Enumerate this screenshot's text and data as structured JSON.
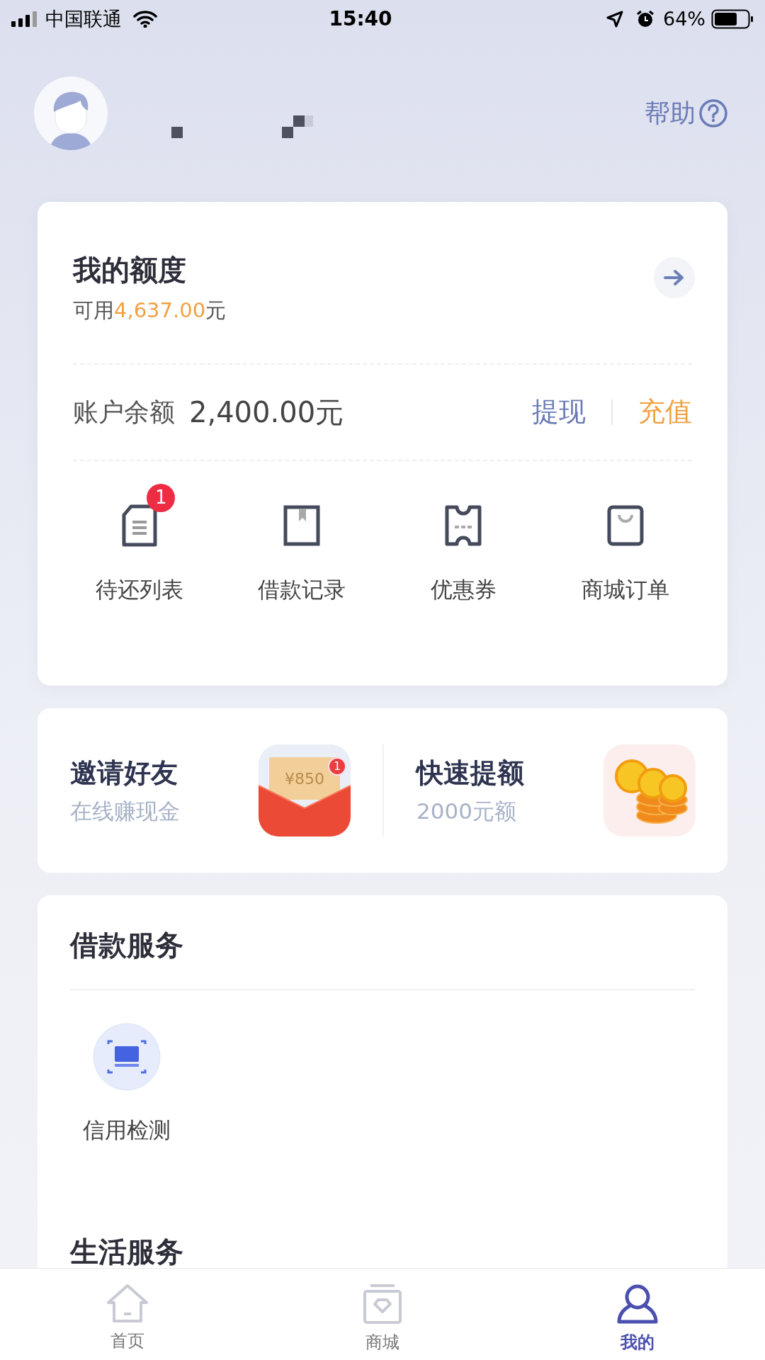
{
  "status_bar": {
    "carrier": "中国联通",
    "time": "15:40",
    "battery": "64%"
  },
  "header": {
    "help": "帮助"
  },
  "credit": {
    "title": "我的额度",
    "available_prefix": "可用",
    "available_amount": "4,637.00",
    "available_suffix": "元",
    "balance_label": "账户余额",
    "balance_value": "2,400.00元",
    "actions": [
      {
        "label": "提现",
        "kind": "withdraw"
      },
      {
        "label": "充值",
        "kind": "recharge"
      }
    ],
    "shortcuts": [
      {
        "label": "待还列表",
        "kind": "document",
        "badge": "1"
      },
      {
        "label": "借款记录",
        "kind": "book"
      },
      {
        "label": "优惠券",
        "kind": "ticket"
      },
      {
        "label": "商城订单",
        "kind": "bag"
      }
    ]
  },
  "promos": [
    {
      "title": "邀请好友",
      "subtitle": "在线赚现金",
      "kind": "envelope",
      "amount": "¥850",
      "badge": "1"
    },
    {
      "title": "快速提额",
      "subtitle": "2000元额",
      "kind": "coins"
    }
  ],
  "loan_services": {
    "title": "借款服务",
    "items": [
      {
        "label": "信用检测"
      }
    ]
  },
  "life_services": {
    "title": "生活服务"
  },
  "tab_bar": [
    {
      "label": "首页",
      "kind": "home",
      "selected": false
    },
    {
      "label": "商城",
      "kind": "shop",
      "selected": false
    },
    {
      "label": "我的",
      "kind": "profile",
      "selected": true
    }
  ]
}
